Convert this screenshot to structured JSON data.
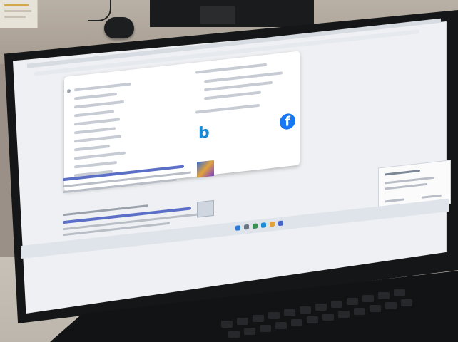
{
  "scene": {
    "subject": "monitor-displaying-browser",
    "colors": {
      "screen": "#eef0f3",
      "bezel": "#151617",
      "desk": "#c7c1b8",
      "bing_blue": "#1a8ad4",
      "facebook_blue": "#1877f2"
    }
  },
  "icons": {
    "bing": "b",
    "facebook": "f"
  }
}
